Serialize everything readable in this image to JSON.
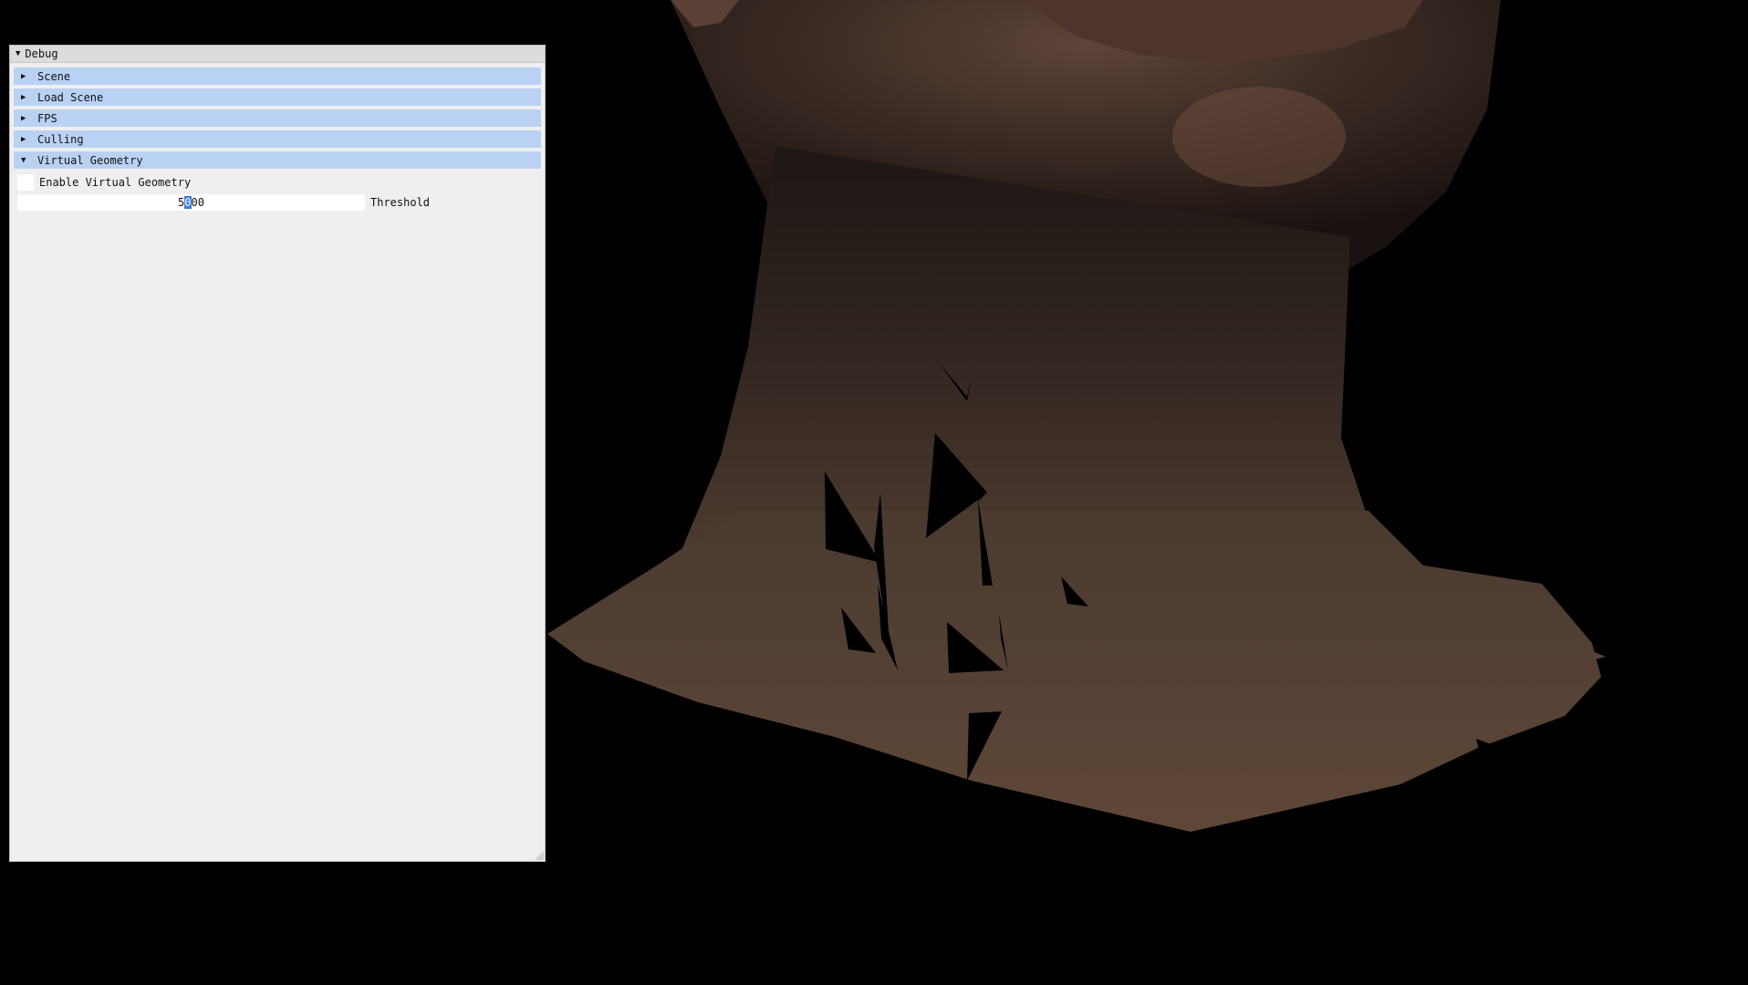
{
  "window": {
    "title": "Debug",
    "title_arrow": "▼"
  },
  "sections": [
    {
      "label": "Scene",
      "arrow": "▶"
    },
    {
      "label": "Load Scene",
      "arrow": "▶"
    },
    {
      "label": "FPS",
      "arrow": "▶"
    },
    {
      "label": "Culling",
      "arrow": "▶"
    },
    {
      "label": "Virtual Geometry",
      "arrow": "▼"
    }
  ],
  "virtual_geometry": {
    "enable_label": "Enable Virtual Geometry",
    "enable_checked": false,
    "threshold_value_pre": "5",
    "threshold_value_sel": "0",
    "threshold_value_post": "00",
    "threshold_label": "Threshold"
  },
  "colors": {
    "header_bg": "#b9d2f4",
    "panel_bg": "#efefef",
    "selection": "#3b7bd6",
    "skin": "#5b4336"
  }
}
